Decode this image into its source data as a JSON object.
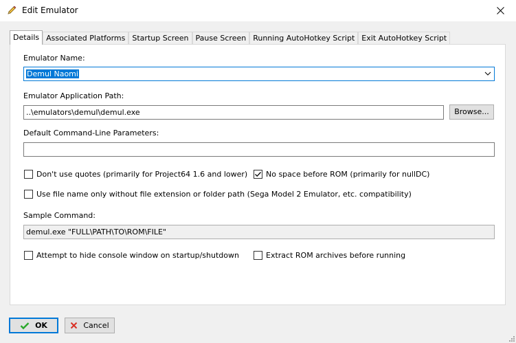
{
  "window": {
    "title": "Edit Emulator"
  },
  "tabs": [
    {
      "label": "Details"
    },
    {
      "label": "Associated Platforms"
    },
    {
      "label": "Startup Screen"
    },
    {
      "label": "Pause Screen"
    },
    {
      "label": "Running AutoHotkey Script"
    },
    {
      "label": "Exit AutoHotkey Script"
    }
  ],
  "details": {
    "emulator_name_label": "Emulator Name:",
    "emulator_name_value": "Demul Naomi",
    "app_path_label": "Emulator Application Path:",
    "app_path_value": "..\\emulators\\demul\\demul.exe",
    "browse_label": "Browse...",
    "params_label": "Default Command-Line Parameters:",
    "params_value": "",
    "dont_use_quotes": {
      "label": "Don't use quotes (primarily for Project64 1.6 and lower)",
      "checked": false
    },
    "no_space_before_rom": {
      "label": "No space before ROM (primarily for nullDC)",
      "checked": true
    },
    "file_name_only": {
      "label": "Use file name only without file extension or folder path (Sega Model 2 Emulator, etc. compatibility)",
      "checked": false
    },
    "sample_command_label": "Sample Command:",
    "sample_command_value": "demul.exe \"FULL\\PATH\\TO\\ROM\\FILE\"",
    "hide_console": {
      "label": "Attempt to hide console window on startup/shutdown",
      "checked": false
    },
    "extract_rom": {
      "label": "Extract ROM archives before running",
      "checked": false
    }
  },
  "buttons": {
    "ok": "OK",
    "cancel": "Cancel"
  },
  "colors": {
    "accent": "#0078d7",
    "ok_check": "#2aa82a",
    "cancel_x": "#d93025"
  }
}
